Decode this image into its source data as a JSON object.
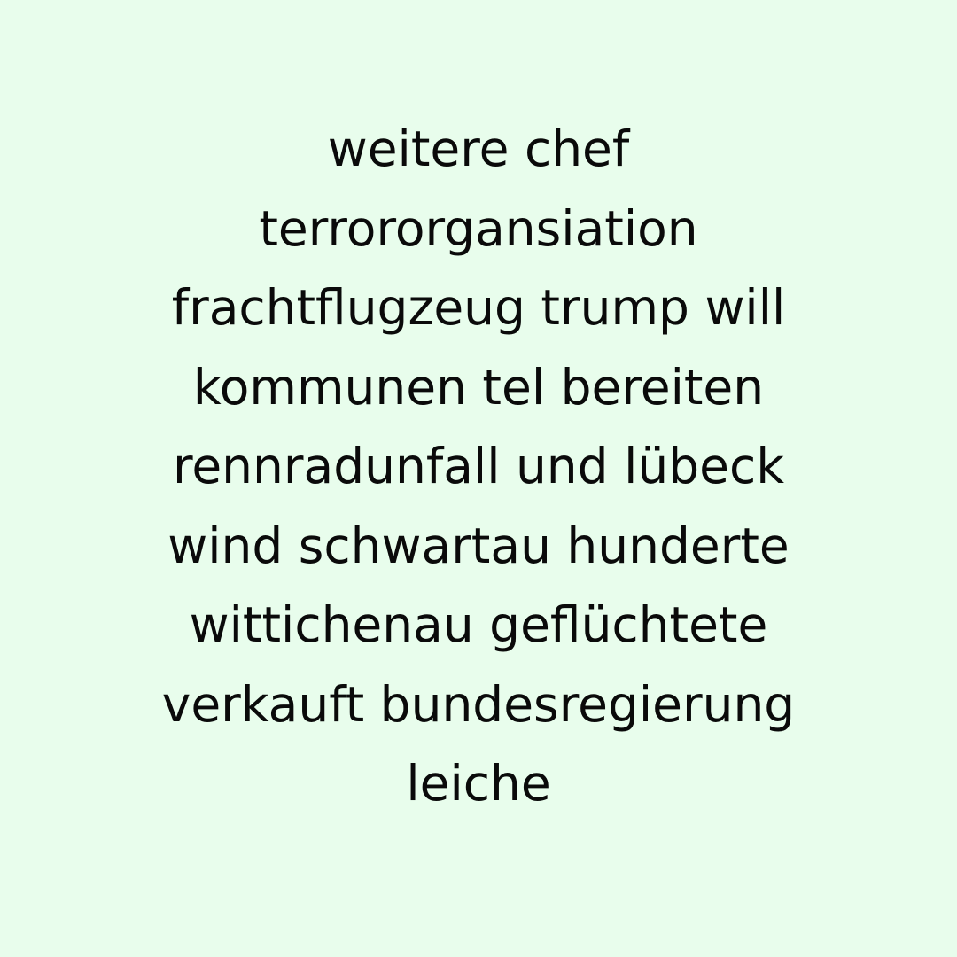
{
  "background_color": "#e8fdec",
  "text_color": "#0a0a0a",
  "lines": [
    "weitere chef",
    "terrororgansiation",
    "frachtflugzeug trump will",
    "kommunen tel bereiten",
    "rennradunfall und lübeck",
    "wind schwartau hunderte",
    "wittichenau geflüchtete",
    "verkauft bundesregierung",
    "leiche"
  ]
}
